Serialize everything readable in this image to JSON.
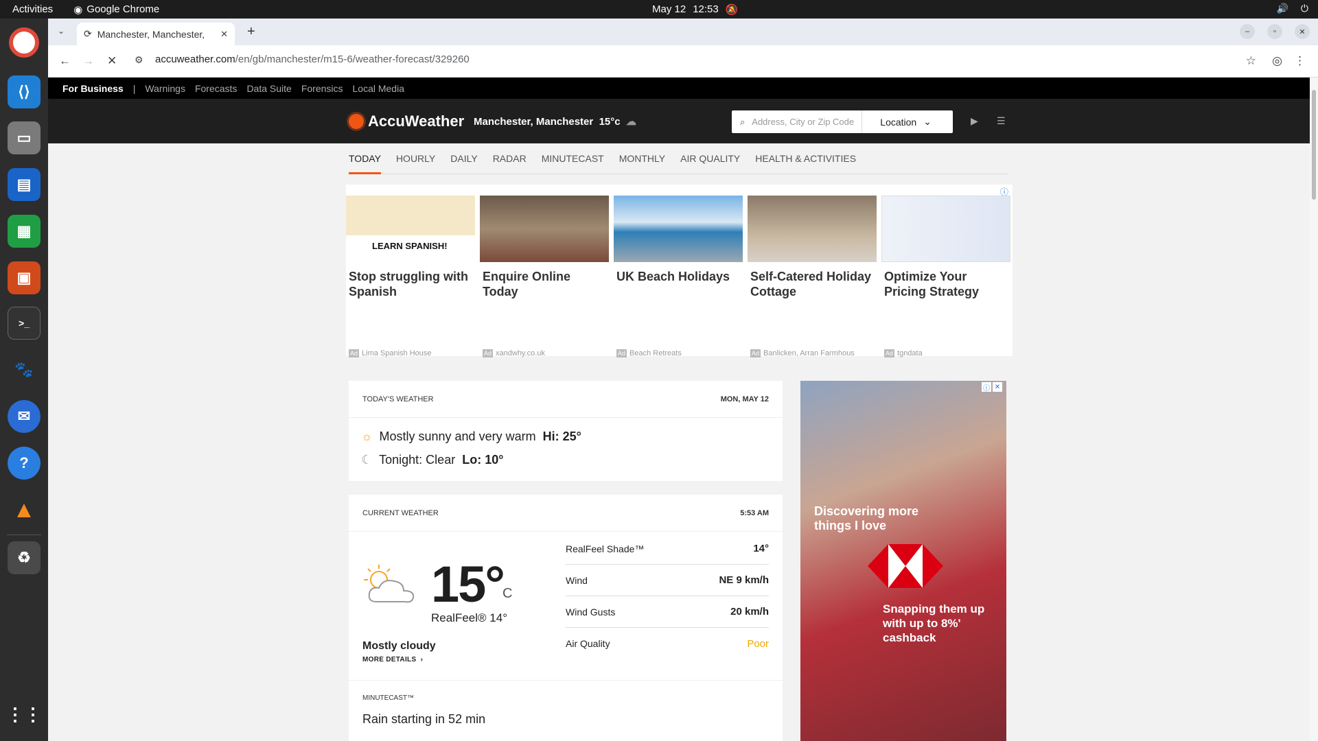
{
  "system": {
    "activities": "Activities",
    "app_name": "Google Chrome",
    "date": "May 12",
    "time": "12:53"
  },
  "browser": {
    "tab_title": "Manchester, Manchester,",
    "url_host": "accuweather.com",
    "url_path": "/en/gb/manchester/m15-6/weather-forecast/329260"
  },
  "site": {
    "business_bar": {
      "for_business": "For Business",
      "separator": "|",
      "links": [
        "Warnings",
        "Forecasts",
        "Data Suite",
        "Forensics",
        "Local Media"
      ]
    },
    "brand": "AccuWeather",
    "location": "Manchester, Manchester",
    "header_temp": "15°c",
    "search_placeholder": "Address, City or Zip Code",
    "location_button": "Location",
    "nav": [
      "TODAY",
      "HOURLY",
      "DAILY",
      "RADAR",
      "MINUTECAST",
      "MONTHLY",
      "AIR QUALITY",
      "HEALTH & ACTIVITIES"
    ]
  },
  "ads": [
    {
      "title": "Stop struggling with Spanish",
      "source": "Lima Spanish House",
      "banner": "LEARN SPANISH!"
    },
    {
      "title": "Enquire Online Today",
      "source": "xandwhy.co.uk"
    },
    {
      "title": "UK Beach Holidays",
      "source": "Beach Retreats"
    },
    {
      "title": "Self-Catered Holiday Cottage",
      "source": "Banlicken, Arran Farmhous"
    },
    {
      "title": "Optimize Your Pricing Strategy",
      "source": "tgndata"
    }
  ],
  "ad_badge": "Ad",
  "today": {
    "label": "TODAY'S WEATHER",
    "date": "MON, MAY 12",
    "day_text": "Mostly sunny and very warm",
    "day_hi": "Hi: 25°",
    "night_text": "Tonight: Clear",
    "night_lo": "Lo: 10°"
  },
  "current": {
    "label": "CURRENT WEATHER",
    "time": "5:53 AM",
    "temp": "15°",
    "unit": "C",
    "realfeel": "RealFeel® 14°",
    "condition": "Mostly cloudy",
    "more": "MORE DETAILS",
    "stats": [
      {
        "label": "RealFeel Shade™",
        "value": "14°"
      },
      {
        "label": "Wind",
        "value": "NE 9 km/h"
      },
      {
        "label": "Wind Gusts",
        "value": "20 km/h"
      },
      {
        "label": "Air Quality",
        "value": "Poor"
      }
    ]
  },
  "minutecast": {
    "label": "MINUTECAST™",
    "text": "Rain starting in 52 min"
  },
  "side_ad": {
    "line1": "Discovering more things I love",
    "line2": "Snapping them up with up to 8%' cashback"
  }
}
